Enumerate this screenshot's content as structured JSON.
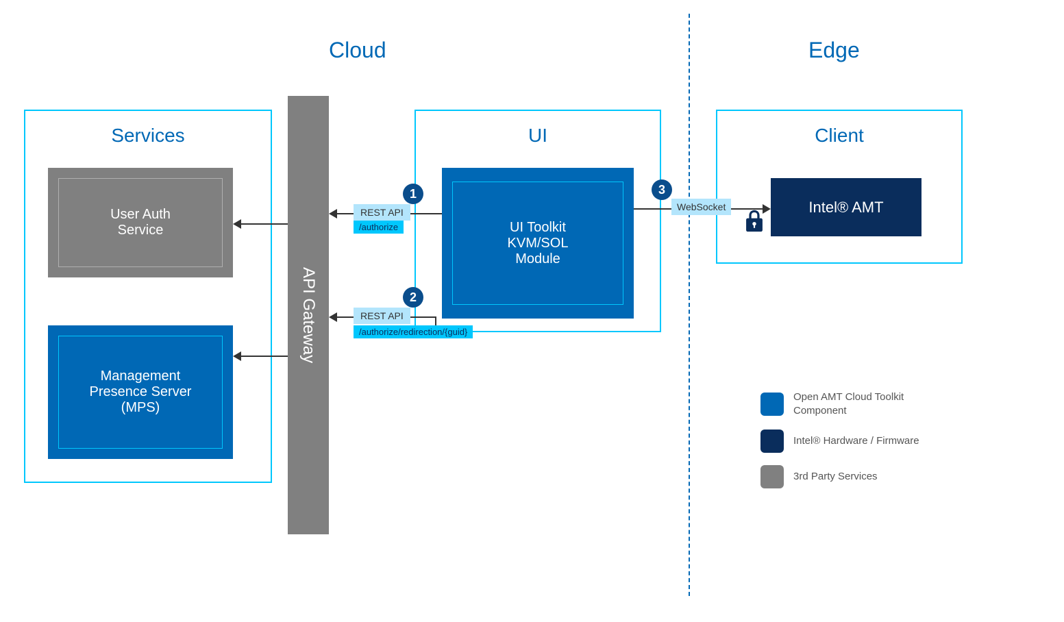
{
  "sections": {
    "cloud": "Cloud",
    "edge": "Edge"
  },
  "boxes": {
    "services": "Services",
    "ui": "UI",
    "client": "Client"
  },
  "components": {
    "user_auth": "User Auth\nService",
    "mps": "Management\nPresence Server\n(MPS)",
    "api_gateway": "API Gateway",
    "ui_toolkit": "UI Toolkit\nKVM/SOL\nModule",
    "intel_amt": "Intel® AMT"
  },
  "connections": {
    "rest_api_1": {
      "number": "1",
      "label": "REST API",
      "endpoint": "/authorize"
    },
    "rest_api_2": {
      "number": "2",
      "label": "REST API",
      "endpoint": "/authorize/redirection/{guid}"
    },
    "websocket": {
      "number": "3",
      "label": "WebSocket"
    }
  },
  "legend": {
    "item1": "Open AMT Cloud Toolkit\nComponent",
    "item2": "Intel® Hardware / Firmware",
    "item3": "3rd Party Services"
  },
  "colors": {
    "blue": "#0068b5",
    "navy": "#0a2d5c",
    "gray": "#808080",
    "cyan": "#00c7fd",
    "lightblue": "#b3e5fc"
  }
}
